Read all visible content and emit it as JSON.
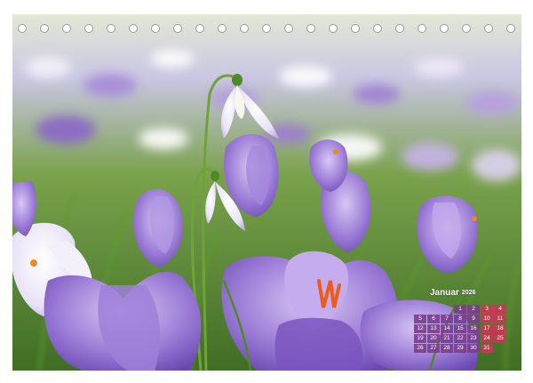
{
  "calendar": {
    "month": "Januar",
    "year": "2026",
    "weeks": [
      [
        "",
        "",
        "",
        "1",
        "2",
        "3",
        "4"
      ],
      [
        "5",
        "6",
        "7",
        "8",
        "9",
        "10",
        "11"
      ],
      [
        "12",
        "13",
        "14",
        "15",
        "16",
        "17",
        "18"
      ],
      [
        "19",
        "20",
        "21",
        "22",
        "23",
        "24",
        "25"
      ],
      [
        "26",
        "27",
        "28",
        "29",
        "30",
        "31",
        ""
      ]
    ]
  },
  "binding": {
    "ring_count": 23
  },
  "colors": {
    "day_cell": "#7a3f8e",
    "weekend_cell": "#c53854",
    "crocus_purple": "#8d6cc7",
    "meadow_green": "#4c7a2c"
  }
}
